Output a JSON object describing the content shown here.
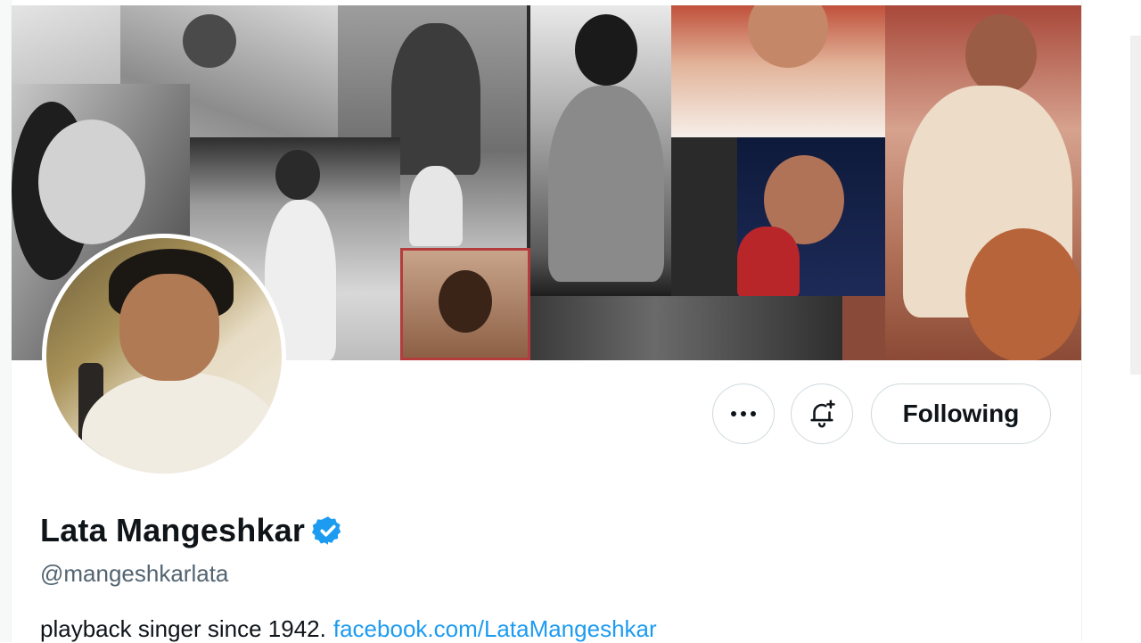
{
  "profile": {
    "display_name": "Lata Mangeshkar",
    "handle": "@mangeshkarlata",
    "bio_text": "playback singer since 1942.",
    "bio_link": "facebook.com/LataMangeshkar",
    "verified": true
  },
  "actions": {
    "follow_label": "Following",
    "more_icon": "more-horizontal-icon",
    "bell_icon": "notification-bell-plus-icon"
  },
  "colors": {
    "accent": "#1d9bf0",
    "text_primary": "#0f1419",
    "text_secondary": "#536471",
    "border": "#cfd9de"
  }
}
